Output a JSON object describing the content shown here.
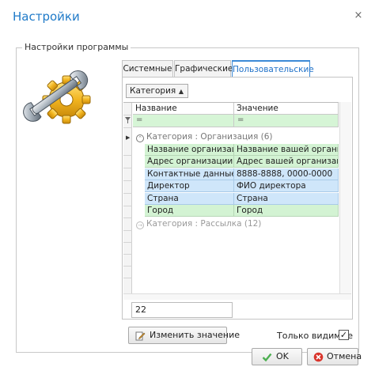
{
  "window": {
    "title": "Настройки",
    "close_glyph": "×"
  },
  "group": {
    "legend": "Настройки программы"
  },
  "logo": {
    "icon": "settings-gear-wrench-icon"
  },
  "tabs": [
    {
      "label": "Системные",
      "active": false
    },
    {
      "label": "Графические",
      "active": false
    },
    {
      "label": "Пользовательские",
      "active": true
    }
  ],
  "grid": {
    "groupby_chip": "Категория",
    "groupby_arrow": "▲",
    "columns": [
      "Название",
      "Значение"
    ],
    "filter_ops": [
      "=",
      "="
    ],
    "filter_icon": "funnel-icon",
    "groups": [
      {
        "caption": "Категория : Организация (6)",
        "expanded": true,
        "toggle_glyph": "⌃",
        "rows": [
          {
            "name": "Название организации",
            "value": "Название вашей организации"
          },
          {
            "name": "Адрес организации",
            "value": "Адрес вашей организации"
          },
          {
            "name": "Контактные данные",
            "value": "8888-8888, 0000-0000"
          },
          {
            "name": "Директор",
            "value": "ФИО директора"
          },
          {
            "name": "Страна",
            "value": "Страна"
          },
          {
            "name": "Город",
            "value": "Город"
          }
        ]
      },
      {
        "caption": "Категория : Рассылка (12)",
        "expanded": false,
        "toggle_glyph": "→"
      }
    ],
    "row_pointer_glyph": "▶"
  },
  "value_editor": {
    "value": "22"
  },
  "buttons": {
    "edit": "Изменить значение",
    "ok": "OK",
    "cancel": "Отмена"
  },
  "only_visible": {
    "label": "Только видимые",
    "checked": true,
    "check_glyph": "✓"
  },
  "colors": {
    "title_blue": "#1f7ac8",
    "row_green": "#d3f3d3",
    "row_blue": "#cfe6fa",
    "filter_green": "#d6f5d6",
    "ok_green": "#4caf50",
    "cancel_red": "#d9342b"
  }
}
